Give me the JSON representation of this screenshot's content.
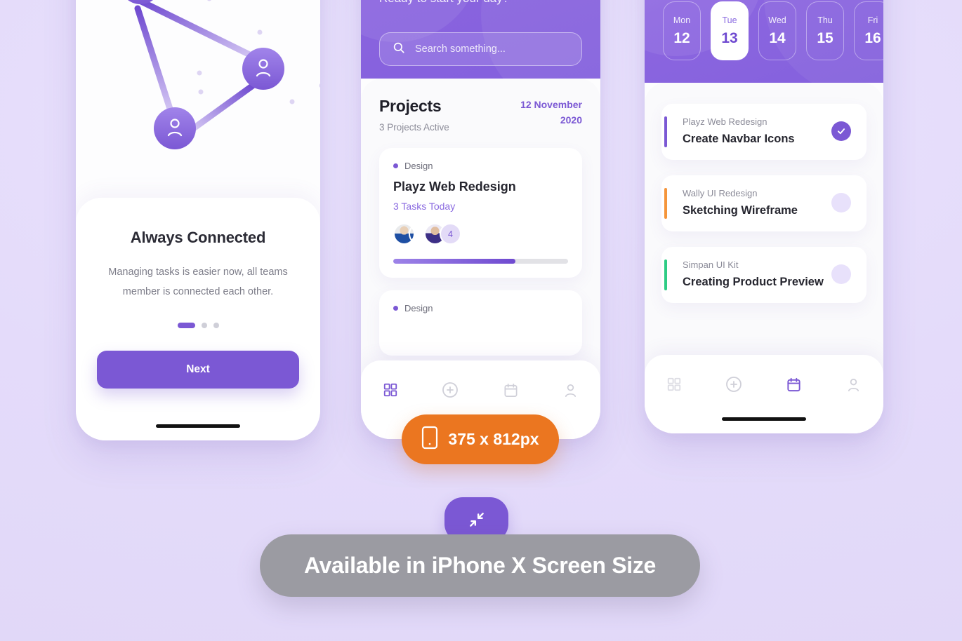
{
  "background_color": "#e4dbfa",
  "accent_color": "#7b58d4",
  "phone1": {
    "title": "Always Connected",
    "description": "Managing tasks is easier now, all teams member is connected each other.",
    "next_label": "Next",
    "dots": 3,
    "active_dot": 1,
    "node_icon": "person-icon"
  },
  "phone2": {
    "greeting": "Ready to start your day?",
    "search_placeholder": "Search something...",
    "search_value": "",
    "search_icon": "search-icon",
    "heading": "Projects",
    "subheading": "3 Projects Active",
    "date_line1": "12 November",
    "date_line2": "2020",
    "cards": [
      {
        "tag": "Design",
        "tag_color": "#7b58d4",
        "title": "Playz Web Redesign",
        "tasks": "3 Tasks Today",
        "avatar_count_label": "4",
        "progress_percent": 70
      },
      {
        "tag": "Design",
        "tag_color": "#7b58d4",
        "title": "",
        "tasks": "",
        "avatar_count_label": "",
        "progress_percent": 0
      }
    ],
    "tabs": [
      {
        "name": "grid-icon",
        "label": "Dashboard",
        "active": true
      },
      {
        "name": "plus-circle-icon",
        "label": "Add",
        "active": false
      },
      {
        "name": "calendar-icon",
        "label": "Calendar",
        "active": false
      },
      {
        "name": "person-icon",
        "label": "Profile",
        "active": false
      }
    ]
  },
  "phone3": {
    "days": [
      {
        "name": "Mon",
        "number": "12",
        "active": false
      },
      {
        "name": "Tue",
        "number": "13",
        "active": true
      },
      {
        "name": "Wed",
        "number": "14",
        "active": false
      },
      {
        "name": "Thu",
        "number": "15",
        "active": false
      },
      {
        "name": "Fri",
        "number": "16",
        "active": false
      }
    ],
    "tasks": [
      {
        "project": "Playz Web Redesign",
        "title": "Create Navbar Icons",
        "bar_color": "#7b58d4",
        "done": true
      },
      {
        "project": "Wally UI Redesign",
        "title": "Sketching Wireframe",
        "bar_color": "#f5953b",
        "done": false
      },
      {
        "project": "Simpan UI Kit",
        "title": "Creating Product Preview",
        "bar_color": "#2ecc85",
        "done": false
      }
    ],
    "tabs": [
      {
        "name": "grid-icon",
        "label": "Dashboard",
        "active": false
      },
      {
        "name": "plus-circle-icon",
        "label": "Add",
        "active": false
      },
      {
        "name": "calendar-icon",
        "label": "Calendar",
        "active": true
      },
      {
        "name": "person-icon",
        "label": "Profile",
        "active": false
      }
    ]
  },
  "badges": {
    "size_label": "375 x 812px",
    "size_icon": "mobile-icon",
    "size_color": "#eb7620",
    "collapse_icon": "collapse-arrows-icon",
    "availability_label": "Available in iPhone X Screen Size",
    "availability_color": "#9b9ba2"
  }
}
